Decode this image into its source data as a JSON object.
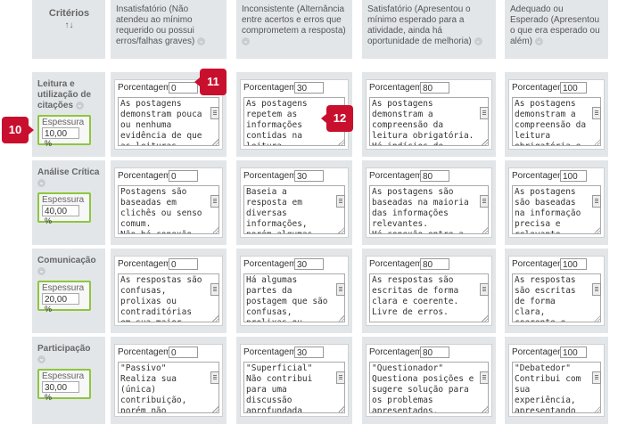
{
  "header": {
    "criteria_label": "Critérios",
    "sort_glyph": "↑↓",
    "columns": [
      "Insatisfatório (Não atendeu ao mínimo requerido ou possui erros/falhas graves)",
      "Inconsistente (Alternância entre acertos e erros que comprometem a resposta)",
      "Satisfatório (Apresentou o mínimo esperado para a atividade, ainda há oportunidade de melhoria)",
      "Adequado ou Esperado (Apresentou o que era esperado ou além)"
    ],
    "chevron_glyph": "⌄"
  },
  "percent_label": "Porcentagem",
  "weight_label": "Espessura",
  "percent_unit": "%",
  "rows": [
    {
      "name": "Leitura e utilização de citações",
      "weight": "10,00",
      "cells": [
        {
          "percent": "0",
          "text": "As postagens demonstram pouca ou nenhuma evidência de que as leituras"
        },
        {
          "percent": "30",
          "text": "As postagens repetem as informações contidas na leitura"
        },
        {
          "percent": "80",
          "text": "As postagens demonstram a compreensão da leitura obrigatória. Há indícios de"
        },
        {
          "percent": "100",
          "text": "As postagens demonstram a compreensão da leitura obrigatória e"
        }
      ]
    },
    {
      "name": "Análise Crítica",
      "weight": "40,00",
      "cells": [
        {
          "percent": "0",
          "text": "Postagens são baseadas em clichês ou senso comum.\nNão há conexão"
        },
        {
          "percent": "30",
          "text": "Baseia a resposta em diversas informações, porém algumas"
        },
        {
          "percent": "80",
          "text": "As postagens são baseadas na maioria das informações relevantes.\nHá conexão entre a"
        },
        {
          "percent": "100",
          "text": "As postagens são baseadas na informação precisa e relevante."
        }
      ]
    },
    {
      "name": "Comunicação",
      "weight": "20,00",
      "cells": [
        {
          "percent": "0",
          "text": "As respostas são confusas, prolixas ou contraditórias em sua maior"
        },
        {
          "percent": "30",
          "text": "Há algumas partes da postagem que são confusas, prolixas ou"
        },
        {
          "percent": "80",
          "text": "As respostas são escritas de forma clara e coerente.\nLivre de erros."
        },
        {
          "percent": "100",
          "text": "As respostas são escritas de forma clara, coerente e"
        }
      ]
    },
    {
      "name": "Participação",
      "weight": "30,00",
      "cells": [
        {
          "percent": "0",
          "text": "\"Passivo\"\nRealiza sua (única) contribuição, porém não"
        },
        {
          "percent": "30",
          "text": "\"Superficial\"\nNão contribui para uma discussão aprofundada"
        },
        {
          "percent": "80",
          "text": "\"Questionador\"\nQuestiona posições e sugere solução para os problemas apresentados,"
        },
        {
          "percent": "100",
          "text": "\"Debatedor\"\nContribui com sua experiência, apresentando"
        }
      ]
    }
  ],
  "badges": {
    "b10": "10",
    "b11": "11",
    "b12": "12"
  },
  "colors": {
    "accent_green": "#8dc63f",
    "badge_red": "#c8102e",
    "header_gray": "#e3e6e9"
  }
}
